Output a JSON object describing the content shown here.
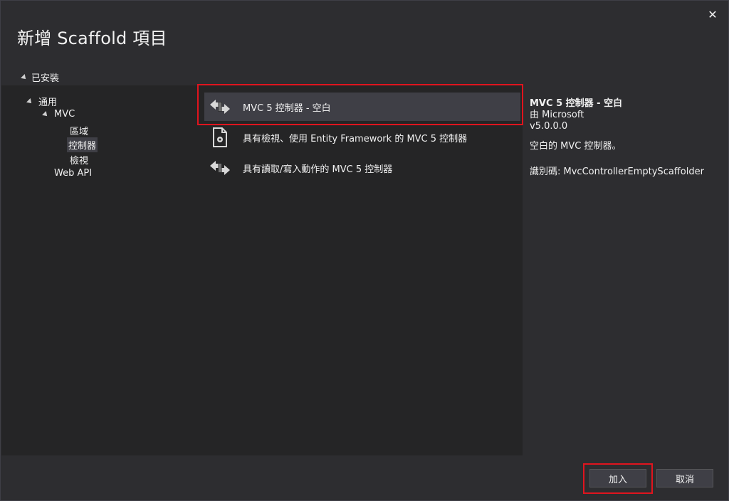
{
  "dialog": {
    "title": "新增 Scaffold 項目",
    "close_glyph": "✕"
  },
  "tree": {
    "root_label": "已安裝",
    "general_label": "通用",
    "mvc_label": "MVC",
    "leaves": [
      "區域",
      "控制器",
      "檢視"
    ],
    "selected_leaf": "控制器",
    "webapi_label": "Web API"
  },
  "templates": [
    {
      "label": "MVC 5 控制器 - 空白",
      "icon": "controller-icon",
      "selected": true
    },
    {
      "label": "具有檢視、使用 Entity Framework 的 MVC 5 控制器",
      "icon": "document-gear-icon",
      "selected": false
    },
    {
      "label": "具有讀取/寫入動作的 MVC 5 控制器",
      "icon": "controller-icon",
      "selected": false
    }
  ],
  "details": {
    "title": "MVC 5 控制器 - 空白",
    "author": "由 Microsoft",
    "version": "v5.0.0.0",
    "description": "空白的 MVC 控制器。",
    "identifier": "識別碼: MvcControllerEmptyScaffolder"
  },
  "buttons": {
    "add_label": "加入",
    "cancel_label": "取消"
  },
  "colors": {
    "background": "#2d2d30",
    "panel": "#252526",
    "selection": "#3f3f46",
    "highlight": "#e0141e"
  }
}
